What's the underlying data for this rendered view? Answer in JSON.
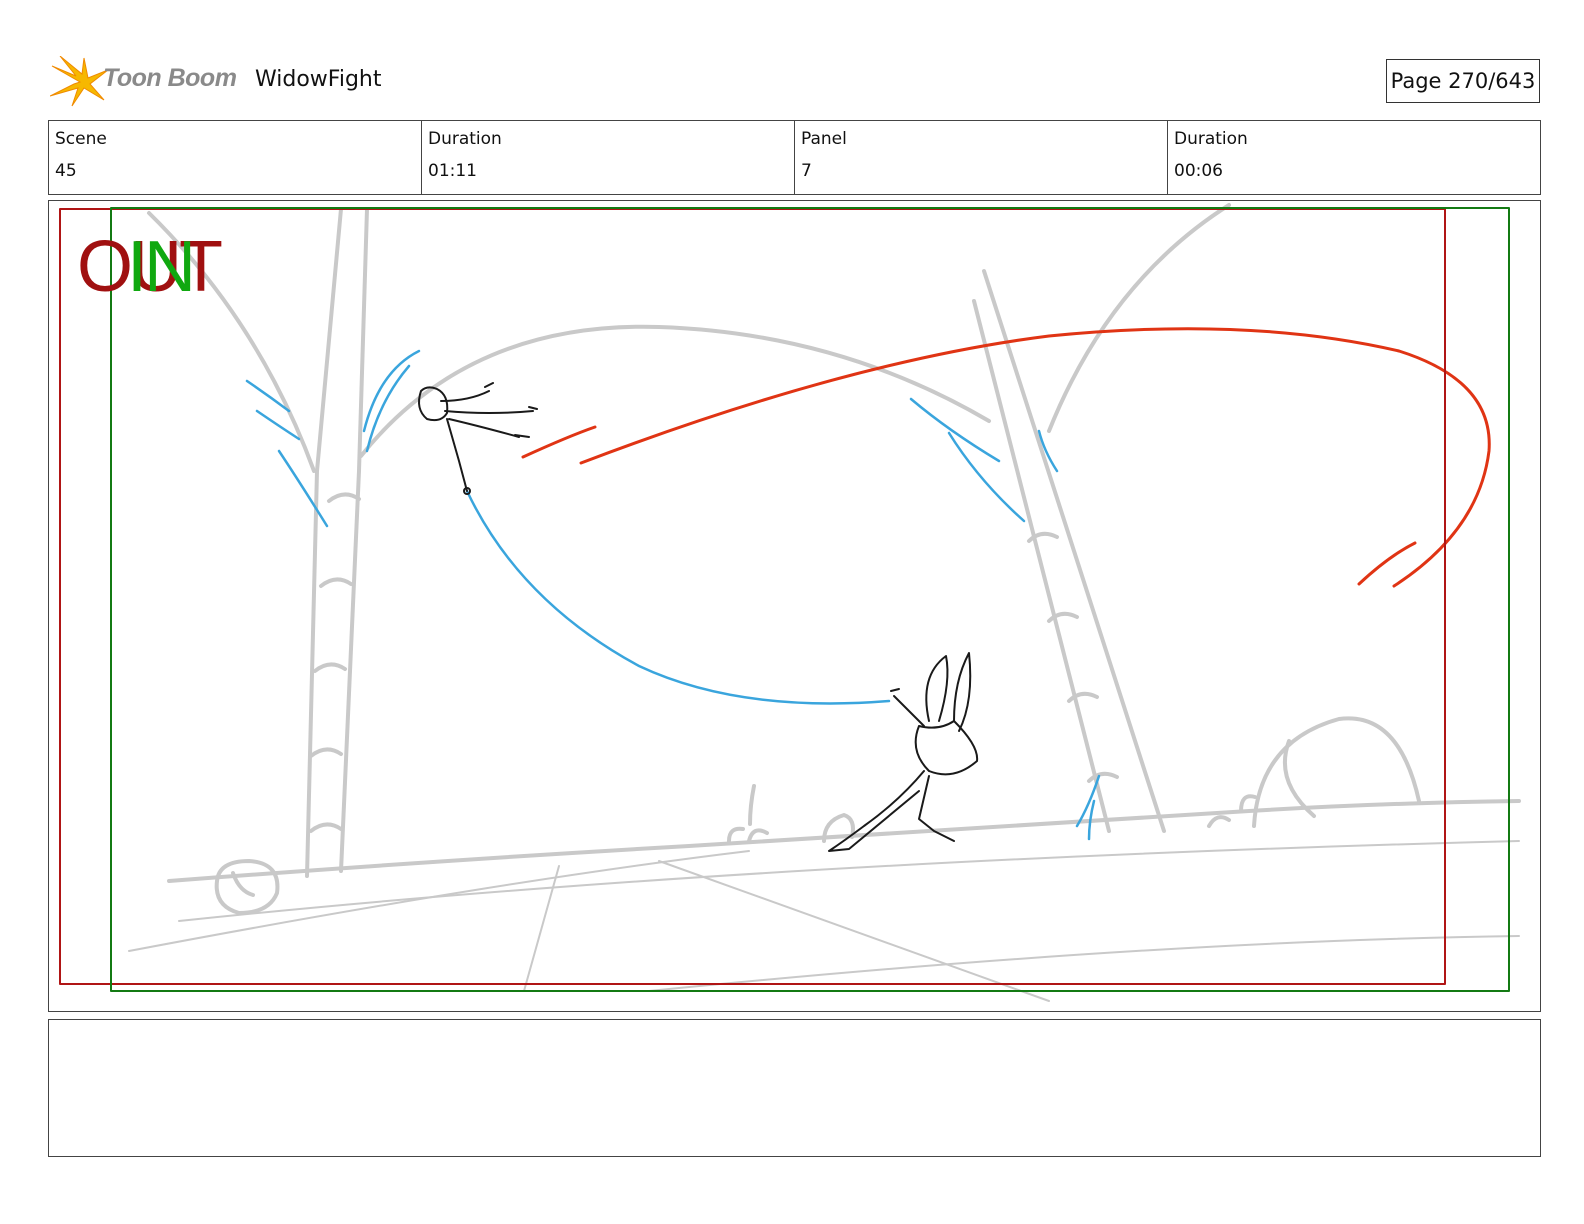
{
  "header": {
    "logo_text": "Toon Boom",
    "project_title": "WidowFight",
    "page_label": "Page 270/643"
  },
  "info": [
    {
      "label": "Scene",
      "value": "45"
    },
    {
      "label": "Duration",
      "value": "01:11"
    },
    {
      "label": "Panel",
      "value": "7"
    },
    {
      "label": "Duration",
      "value": "00:06"
    }
  ],
  "panel": {
    "out_label": "OUT",
    "in_label": "IN",
    "colors": {
      "out_frame": "#b01515",
      "in_frame": "#137a13",
      "sketch": "#c9c9c9",
      "action_red": "#e03414",
      "action_blue": "#3aa5dd",
      "character": "#1a1a1a"
    }
  },
  "notes": {
    "text": ""
  }
}
